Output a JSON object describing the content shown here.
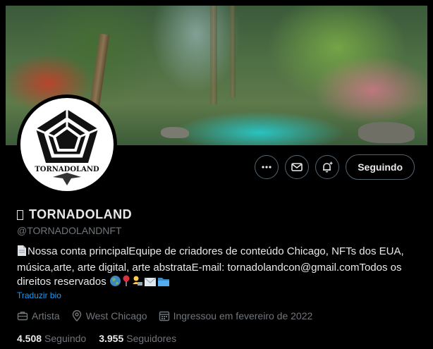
{
  "profile": {
    "name": "TORNADOLAND",
    "handle": "@TORNADOLANDNFT",
    "avatar_text": "TORNADOLAND",
    "bio": "Nossa conta principalEquipe de criadores de conteúdo Chicago, NFTs dos EUA, música,arte, arte digital, arte abstrataE-mail: tornadolandcon@gmail.comTodos os direitos reservados",
    "translate_label": "Traduzir bio"
  },
  "actions": {
    "more_icon": "more-horizontal-icon",
    "message_icon": "mail-icon",
    "notify_icon": "bell-plus-icon",
    "follow_label": "Seguindo"
  },
  "meta": {
    "category": "Artista",
    "location": "West Chicago",
    "joined": "Ingressou em fevereiro de 2022"
  },
  "stats": {
    "following_count": "4.508",
    "following_label": "Seguindo",
    "followers_count": "3.955",
    "followers_label": "Seguidores"
  },
  "colors": {
    "background": "#000000",
    "text_primary": "#e7e9ea",
    "text_secondary": "#71767b",
    "link": "#1d9bf0",
    "border": "#536471"
  }
}
